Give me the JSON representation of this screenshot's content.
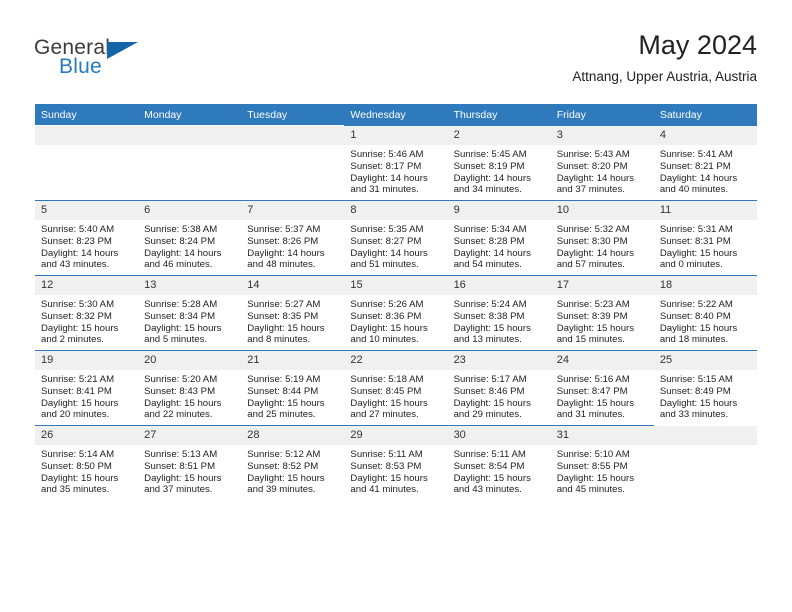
{
  "brand": {
    "name_top": "General",
    "name_bottom": "Blue",
    "triangle_color": "#1464aa",
    "blue_color": "#2a7ac0"
  },
  "header": {
    "title": "May 2024",
    "subtitle": "Attnang, Upper Austria, Austria"
  },
  "theme": {
    "header_blue": "#2f79bd",
    "daynum_band": "#f0f0f0",
    "text": "#222222"
  },
  "calendar": {
    "weekday_headers": [
      "Sunday",
      "Monday",
      "Tuesday",
      "Wednesday",
      "Thursday",
      "Friday",
      "Saturday"
    ],
    "weeks": [
      [
        {
          "day": "",
          "lines": []
        },
        {
          "day": "",
          "lines": []
        },
        {
          "day": "",
          "lines": []
        },
        {
          "day": "1",
          "lines": [
            "Sunrise: 5:46 AM",
            "Sunset: 8:17 PM",
            "Daylight: 14 hours",
            "and 31 minutes."
          ]
        },
        {
          "day": "2",
          "lines": [
            "Sunrise: 5:45 AM",
            "Sunset: 8:19 PM",
            "Daylight: 14 hours",
            "and 34 minutes."
          ]
        },
        {
          "day": "3",
          "lines": [
            "Sunrise: 5:43 AM",
            "Sunset: 8:20 PM",
            "Daylight: 14 hours",
            "and 37 minutes."
          ]
        },
        {
          "day": "4",
          "lines": [
            "Sunrise: 5:41 AM",
            "Sunset: 8:21 PM",
            "Daylight: 14 hours",
            "and 40 minutes."
          ]
        }
      ],
      [
        {
          "day": "5",
          "lines": [
            "Sunrise: 5:40 AM",
            "Sunset: 8:23 PM",
            "Daylight: 14 hours",
            "and 43 minutes."
          ]
        },
        {
          "day": "6",
          "lines": [
            "Sunrise: 5:38 AM",
            "Sunset: 8:24 PM",
            "Daylight: 14 hours",
            "and 46 minutes."
          ]
        },
        {
          "day": "7",
          "lines": [
            "Sunrise: 5:37 AM",
            "Sunset: 8:26 PM",
            "Daylight: 14 hours",
            "and 48 minutes."
          ]
        },
        {
          "day": "8",
          "lines": [
            "Sunrise: 5:35 AM",
            "Sunset: 8:27 PM",
            "Daylight: 14 hours",
            "and 51 minutes."
          ]
        },
        {
          "day": "9",
          "lines": [
            "Sunrise: 5:34 AM",
            "Sunset: 8:28 PM",
            "Daylight: 14 hours",
            "and 54 minutes."
          ]
        },
        {
          "day": "10",
          "lines": [
            "Sunrise: 5:32 AM",
            "Sunset: 8:30 PM",
            "Daylight: 14 hours",
            "and 57 minutes."
          ]
        },
        {
          "day": "11",
          "lines": [
            "Sunrise: 5:31 AM",
            "Sunset: 8:31 PM",
            "Daylight: 15 hours",
            "and 0 minutes."
          ]
        }
      ],
      [
        {
          "day": "12",
          "lines": [
            "Sunrise: 5:30 AM",
            "Sunset: 8:32 PM",
            "Daylight: 15 hours",
            "and 2 minutes."
          ]
        },
        {
          "day": "13",
          "lines": [
            "Sunrise: 5:28 AM",
            "Sunset: 8:34 PM",
            "Daylight: 15 hours",
            "and 5 minutes."
          ]
        },
        {
          "day": "14",
          "lines": [
            "Sunrise: 5:27 AM",
            "Sunset: 8:35 PM",
            "Daylight: 15 hours",
            "and 8 minutes."
          ]
        },
        {
          "day": "15",
          "lines": [
            "Sunrise: 5:26 AM",
            "Sunset: 8:36 PM",
            "Daylight: 15 hours",
            "and 10 minutes."
          ]
        },
        {
          "day": "16",
          "lines": [
            "Sunrise: 5:24 AM",
            "Sunset: 8:38 PM",
            "Daylight: 15 hours",
            "and 13 minutes."
          ]
        },
        {
          "day": "17",
          "lines": [
            "Sunrise: 5:23 AM",
            "Sunset: 8:39 PM",
            "Daylight: 15 hours",
            "and 15 minutes."
          ]
        },
        {
          "day": "18",
          "lines": [
            "Sunrise: 5:22 AM",
            "Sunset: 8:40 PM",
            "Daylight: 15 hours",
            "and 18 minutes."
          ]
        }
      ],
      [
        {
          "day": "19",
          "lines": [
            "Sunrise: 5:21 AM",
            "Sunset: 8:41 PM",
            "Daylight: 15 hours",
            "and 20 minutes."
          ]
        },
        {
          "day": "20",
          "lines": [
            "Sunrise: 5:20 AM",
            "Sunset: 8:43 PM",
            "Daylight: 15 hours",
            "and 22 minutes."
          ]
        },
        {
          "day": "21",
          "lines": [
            "Sunrise: 5:19 AM",
            "Sunset: 8:44 PM",
            "Daylight: 15 hours",
            "and 25 minutes."
          ]
        },
        {
          "day": "22",
          "lines": [
            "Sunrise: 5:18 AM",
            "Sunset: 8:45 PM",
            "Daylight: 15 hours",
            "and 27 minutes."
          ]
        },
        {
          "day": "23",
          "lines": [
            "Sunrise: 5:17 AM",
            "Sunset: 8:46 PM",
            "Daylight: 15 hours",
            "and 29 minutes."
          ]
        },
        {
          "day": "24",
          "lines": [
            "Sunrise: 5:16 AM",
            "Sunset: 8:47 PM",
            "Daylight: 15 hours",
            "and 31 minutes."
          ]
        },
        {
          "day": "25",
          "lines": [
            "Sunrise: 5:15 AM",
            "Sunset: 8:49 PM",
            "Daylight: 15 hours",
            "and 33 minutes."
          ]
        }
      ],
      [
        {
          "day": "26",
          "lines": [
            "Sunrise: 5:14 AM",
            "Sunset: 8:50 PM",
            "Daylight: 15 hours",
            "and 35 minutes."
          ]
        },
        {
          "day": "27",
          "lines": [
            "Sunrise: 5:13 AM",
            "Sunset: 8:51 PM",
            "Daylight: 15 hours",
            "and 37 minutes."
          ]
        },
        {
          "day": "28",
          "lines": [
            "Sunrise: 5:12 AM",
            "Sunset: 8:52 PM",
            "Daylight: 15 hours",
            "and 39 minutes."
          ]
        },
        {
          "day": "29",
          "lines": [
            "Sunrise: 5:11 AM",
            "Sunset: 8:53 PM",
            "Daylight: 15 hours",
            "and 41 minutes."
          ]
        },
        {
          "day": "30",
          "lines": [
            "Sunrise: 5:11 AM",
            "Sunset: 8:54 PM",
            "Daylight: 15 hours",
            "and 43 minutes."
          ]
        },
        {
          "day": "31",
          "lines": [
            "Sunrise: 5:10 AM",
            "Sunset: 8:55 PM",
            "Daylight: 15 hours",
            "and 45 minutes."
          ]
        },
        {
          "day": "",
          "lines": []
        }
      ]
    ]
  }
}
